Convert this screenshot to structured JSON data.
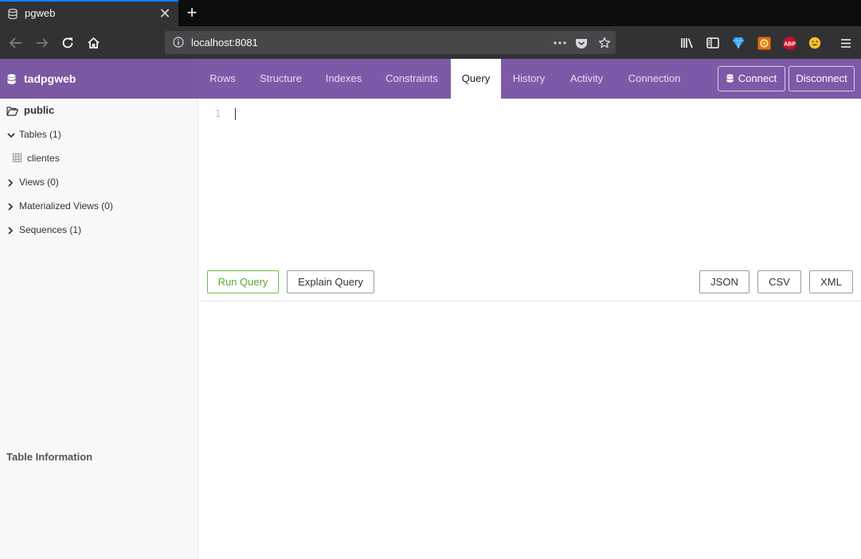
{
  "browser": {
    "tab_title": "pgweb",
    "url": "localhost:8081",
    "icons": [
      "back-icon",
      "forward-icon",
      "reload-icon",
      "home-icon",
      "site-info-icon",
      "more-icon",
      "pocket-icon",
      "bookmark-star-icon",
      "library-icon",
      "sidebar-icon",
      "extension-diamond-icon",
      "extension-gear-icon",
      "adblock-icon",
      "extension-emoji-icon",
      "menu-icon"
    ],
    "adblock_label": "ABP"
  },
  "app": {
    "brand": "tadpgweb",
    "tabs": [
      "Rows",
      "Structure",
      "Indexes",
      "Constraints",
      "Query",
      "History",
      "Activity",
      "Connection"
    ],
    "active_tab": "Query",
    "connect_label": "Connect",
    "disconnect_label": "Disconnect",
    "accent": "#7d5aa7"
  },
  "sidebar": {
    "schema": "public",
    "groups": {
      "tables": "Tables (1)",
      "table_item": "clientes",
      "views": "Views (0)",
      "mviews": "Materialized Views (0)",
      "sequences": "Sequences (1)"
    },
    "table_info_title": "Table Information"
  },
  "editor": {
    "line_number": "1",
    "content": ""
  },
  "actions": {
    "run": "Run Query",
    "explain": "Explain Query",
    "json": "JSON",
    "csv": "CSV",
    "xml": "XML"
  }
}
